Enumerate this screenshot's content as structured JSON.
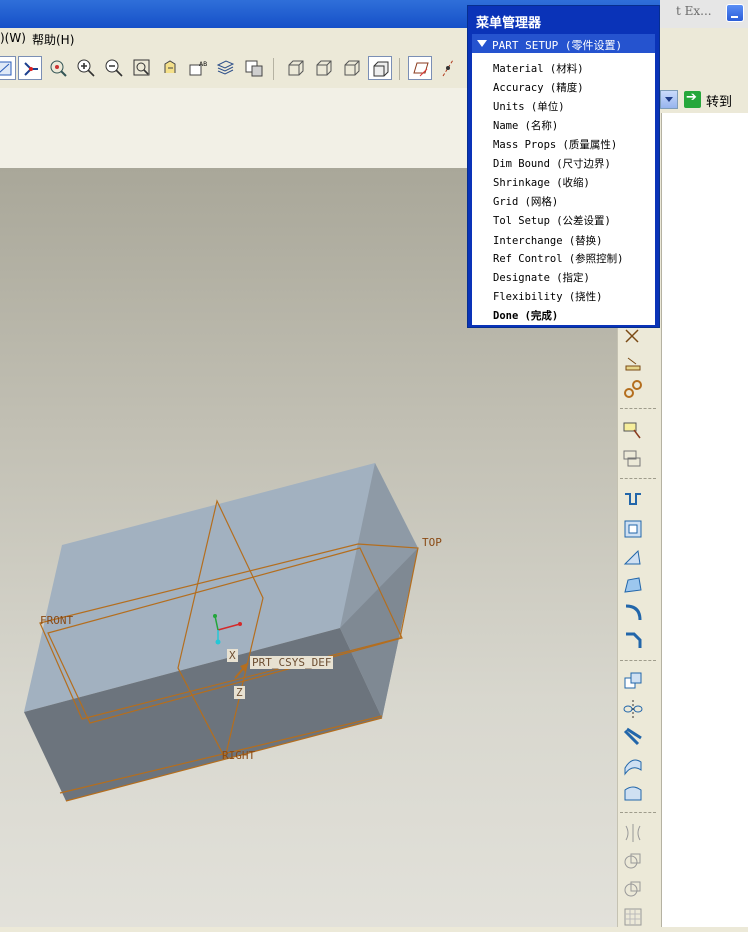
{
  "window": {
    "right_title_fragment": "t Ex..."
  },
  "menubar": {
    "left_fragment": ")(W)",
    "help": "帮助(H)"
  },
  "goto_label": "转到",
  "menu_manager": {
    "title": "菜单管理器",
    "header": "PART SETUP (零件设置)",
    "items": [
      "Material (材料)",
      "Accuracy (精度)",
      "Units (单位)",
      "Name (名称)",
      "Mass Props (质量属性)",
      "Dim Bound (尺寸边界)",
      "Shrinkage (收缩)",
      "Grid (网格)",
      "Tol Setup (公差设置)",
      "Interchange (替换)",
      "Ref Control (参照控制)",
      "Designate (指定)",
      "Flexibility (挠性)"
    ],
    "done": "Done (完成)"
  },
  "model": {
    "datum_labels": {
      "front": "FRONT",
      "top": "TOP",
      "right": "RIGHT"
    },
    "csys_label": "PRT_CSYS_DEF",
    "axis_x": "X",
    "axis_z": "Z",
    "part_color": "#a3b2c2",
    "datum_color": "#b46e1e"
  }
}
